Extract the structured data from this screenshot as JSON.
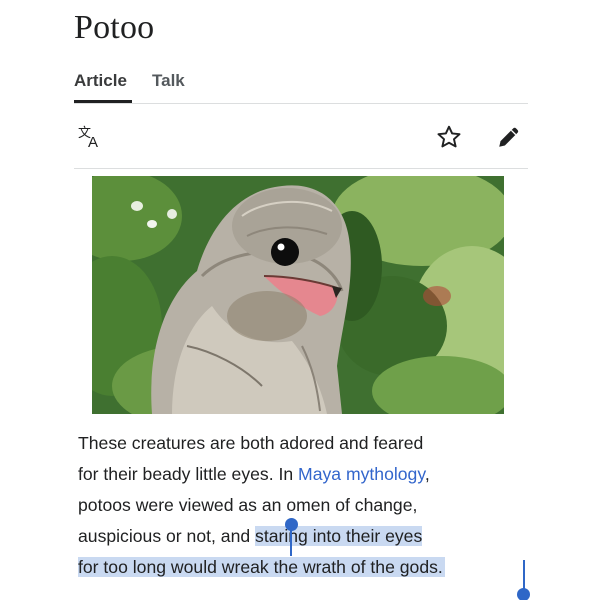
{
  "article": {
    "title": "Potoo",
    "tabs": [
      {
        "label": "Article",
        "active": true
      },
      {
        "label": "Talk",
        "active": false
      }
    ]
  },
  "toolbar": {
    "icons": [
      "language-icon",
      "star-icon",
      "edit-pencil-icon"
    ]
  },
  "image": {
    "subject": "potoo bird photo"
  },
  "paragraph": {
    "line1": "These creatures are both adored and feared",
    "line2_pre": "for their beady little eyes. In ",
    "line2_link": "Maya mythology",
    "line2_post": ",",
    "line3": "potoos were viewed as an omen of change,",
    "line4_pre": "auspicious or not, and ",
    "line4_sel": "staring into their eyes",
    "line5_sel": "for too long would wreak the wrath of the gods."
  },
  "colors": {
    "link": "#3366cc",
    "selection": "#c9d9f1",
    "selection_handle": "#2f67c7",
    "text": "#202122"
  }
}
